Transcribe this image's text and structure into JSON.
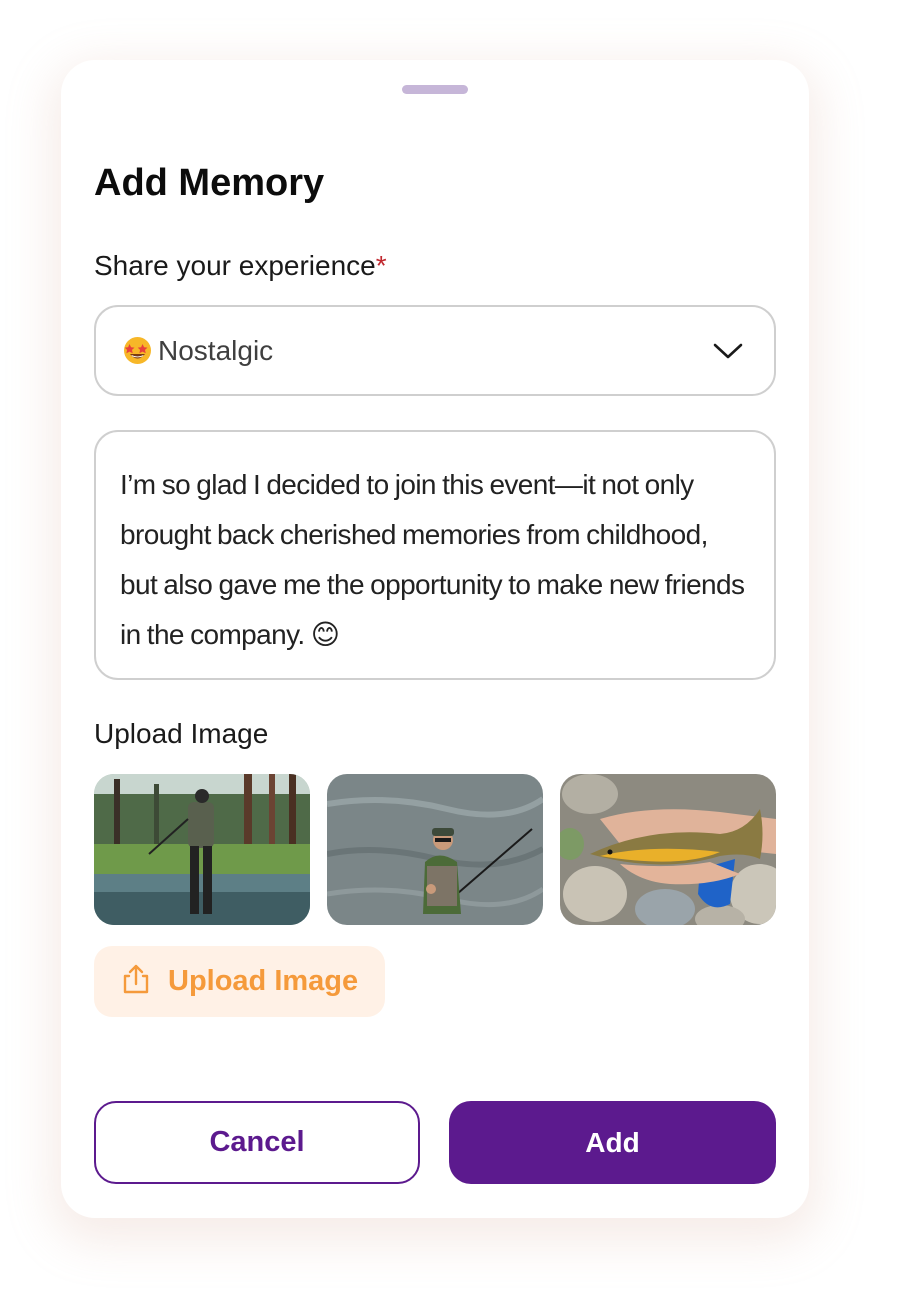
{
  "dialog": {
    "title": "Add Memory"
  },
  "experience": {
    "label": "Share your experience",
    "required_marker": "*",
    "selected_emoji_icon": "star-struck-emoji",
    "selected_value": "Nostalgic",
    "dropdown_icon": "chevron-down-icon"
  },
  "memory_text": {
    "value": "I’m so glad I decided to join this event—it not only brought back cherished memories from childhood, but also gave me the opportunity to make new friends in the company. 😊"
  },
  "images": {
    "label": "Upload Image",
    "thumbnails": [
      {
        "icon": "photo-angler-in-river"
      },
      {
        "icon": "photo-fisherman-wading"
      },
      {
        "icon": "photo-trout-in-hands"
      }
    ],
    "upload_button_label": "Upload Image",
    "upload_icon": "upload-icon"
  },
  "actions": {
    "cancel_label": "Cancel",
    "add_label": "Add"
  },
  "colors": {
    "primary": "#5c1a8e",
    "accent_orange": "#f59a3b",
    "accent_orange_bg": "#fff1e6",
    "required_red": "#c0282f",
    "border": "#cfcfcf"
  }
}
